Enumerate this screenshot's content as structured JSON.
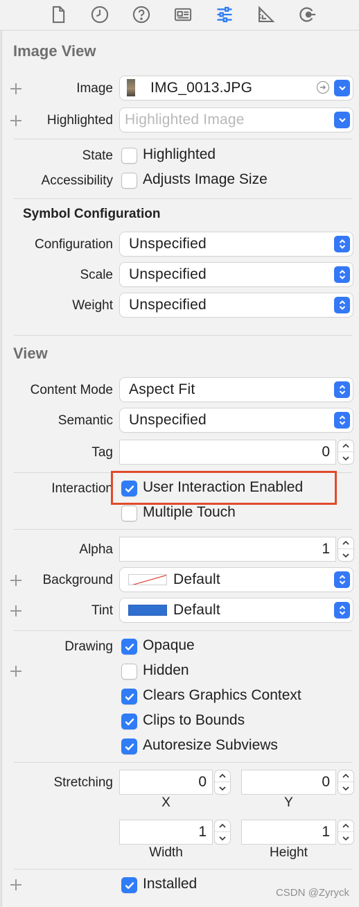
{
  "tabs": [
    {
      "icon": "file-icon"
    },
    {
      "icon": "history-icon"
    },
    {
      "icon": "help-icon"
    },
    {
      "icon": "identity-icon"
    },
    {
      "icon": "attributes-icon",
      "selected": true
    },
    {
      "icon": "size-icon"
    },
    {
      "icon": "connections-icon"
    }
  ],
  "image_view": {
    "title": "Image View",
    "image_label": "Image",
    "image_value": "IMG_0013.JPG",
    "highlighted_label": "Highlighted",
    "highlighted_placeholder": "Highlighted Image",
    "state_label": "State",
    "state_checkbox": "Highlighted",
    "accessibility_label": "Accessibility",
    "accessibility_checkbox": "Adjusts Image Size"
  },
  "symbol_config": {
    "title": "Symbol Configuration",
    "configuration_label": "Configuration",
    "configuration_value": "Unspecified",
    "scale_label": "Scale",
    "scale_value": "Unspecified",
    "weight_label": "Weight",
    "weight_value": "Unspecified"
  },
  "view": {
    "title": "View",
    "content_mode_label": "Content Mode",
    "content_mode_value": "Aspect Fit",
    "semantic_label": "Semantic",
    "semantic_value": "Unspecified",
    "tag_label": "Tag",
    "tag_value": "0",
    "interaction_label": "Interaction",
    "user_interaction": "User Interaction Enabled",
    "multiple_touch": "Multiple Touch",
    "alpha_label": "Alpha",
    "alpha_value": "1",
    "background_label": "Background",
    "background_value": "Default",
    "tint_label": "Tint",
    "tint_value": "Default",
    "drawing_label": "Drawing",
    "opaque": "Opaque",
    "hidden": "Hidden",
    "clears_graphics": "Clears Graphics Context",
    "clips_to_bounds": "Clips to Bounds",
    "autoresize": "Autoresize Subviews",
    "stretching_label": "Stretching",
    "stretch_x": "0",
    "stretch_y": "0",
    "stretch_width": "1",
    "stretch_height": "1",
    "x_label": "X",
    "y_label": "Y",
    "width_label": "Width",
    "height_label": "Height",
    "installed": "Installed"
  },
  "watermark": "CSDN @Zyryck",
  "colors": {
    "accent": "#3478f6",
    "checkbox_on": "#2f7cf6",
    "highlight_box": "#e14a2b",
    "tint_swatch": "#2f6fd0"
  }
}
